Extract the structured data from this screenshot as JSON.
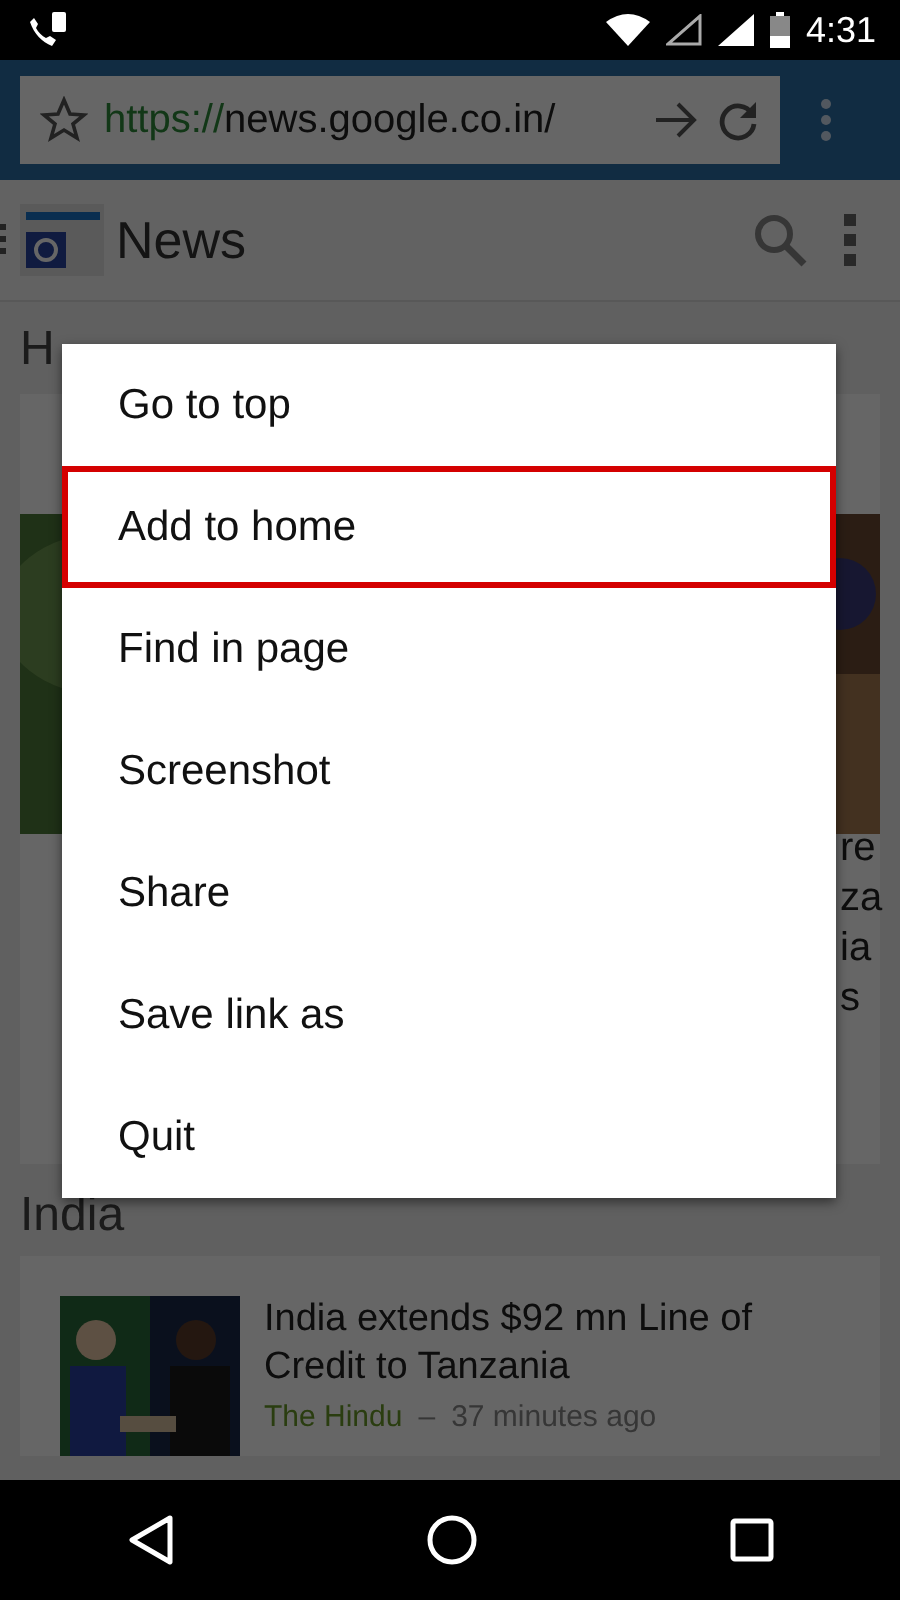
{
  "status_bar": {
    "time": "4:31"
  },
  "browser": {
    "url_scheme": "https://",
    "url_rest": "news.google.co.in/"
  },
  "app_header": {
    "title": "News"
  },
  "sections": [
    {
      "title": "H",
      "fragments": [
        "re",
        "za",
        "ia",
        "s"
      ]
    },
    {
      "title": "India",
      "story": {
        "headline": "India extends $92 mn Line of Credit to Tanzania",
        "source": "The Hindu",
        "separator": "–",
        "time": "37 minutes ago"
      }
    }
  ],
  "menu": {
    "items": [
      {
        "label": "Go to top",
        "selected": false
      },
      {
        "label": "Add to home",
        "selected": true
      },
      {
        "label": "Find in page",
        "selected": false
      },
      {
        "label": "Screenshot",
        "selected": false
      },
      {
        "label": "Share",
        "selected": false
      },
      {
        "label": "Save link as",
        "selected": false
      },
      {
        "label": "Quit",
        "selected": false
      }
    ]
  }
}
